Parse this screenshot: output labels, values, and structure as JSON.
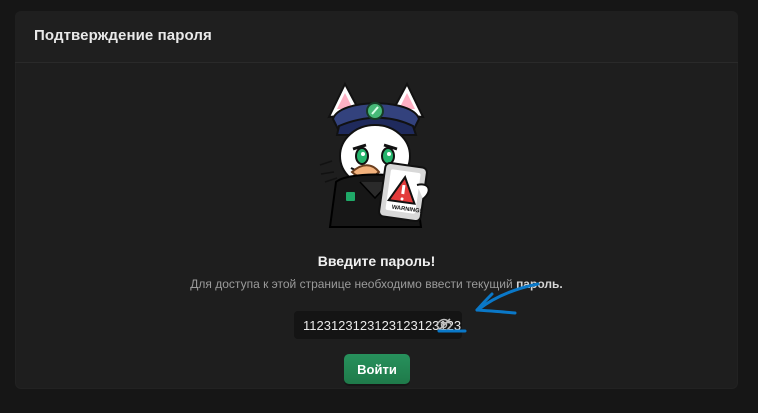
{
  "dialog": {
    "title": "Подтверждение пароля",
    "heading": "Введите пароль!",
    "description_prefix": "Для доступа к этой странице необходимо ввести текущий",
    "description_emphasis": "пароль.",
    "password_value": "11231231231231231231231",
    "submit_label": "Войти",
    "mascot_warning_text": "WARNING!"
  },
  "colors": {
    "page_background": "#161616",
    "card_background": "#1e1e1e",
    "accent_green": "#27915c",
    "annotation_blue": "#0a78c8"
  },
  "icons": {
    "mascot": "cat-officer-mascot",
    "visibility": "eye-slash-icon",
    "annotation": "blue-arrow"
  }
}
